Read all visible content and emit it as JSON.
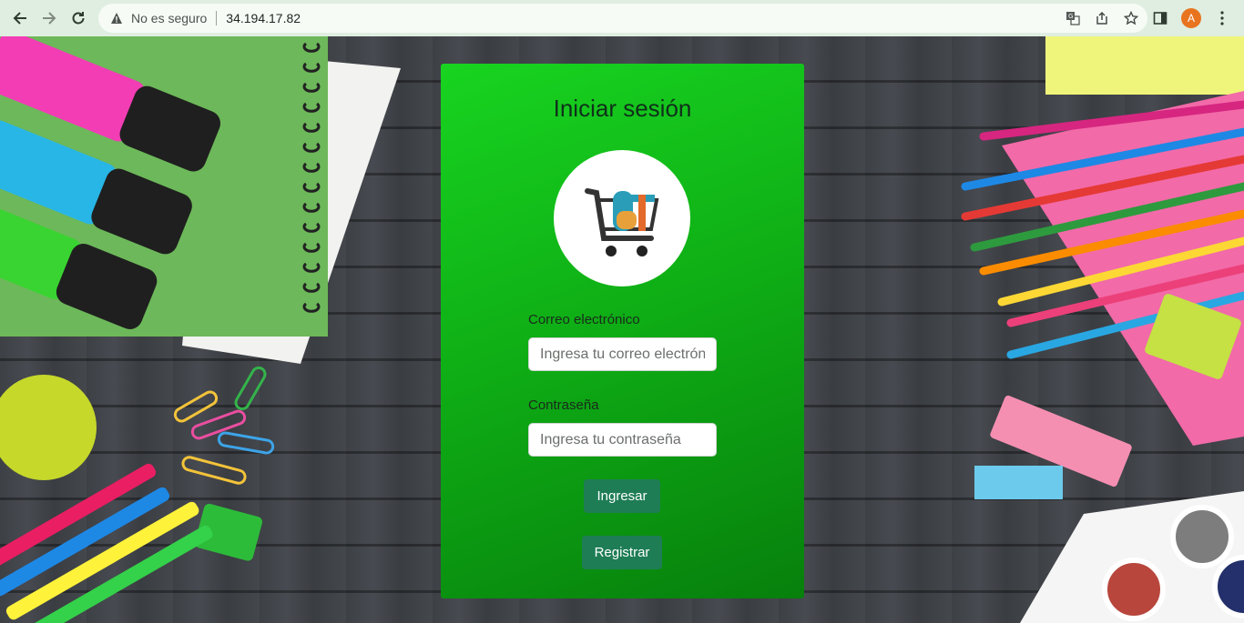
{
  "browser": {
    "security_label": "No es seguro",
    "url": "34.194.17.82",
    "avatar_letter": "A",
    "icons": [
      "back-icon",
      "forward-icon",
      "reload-icon",
      "warning-icon",
      "translate-icon",
      "share-icon",
      "bookmark-star-icon",
      "side-panel-icon",
      "profile-avatar",
      "menu-kebab-icon"
    ]
  },
  "login": {
    "title": "Iniciar sesión",
    "email_label": "Correo electrónico",
    "email_placeholder": "Ingresa tu correo electrónico",
    "password_label": "Contraseña",
    "password_placeholder": "Ingresa tu contraseña",
    "submit_label": "Ingresar",
    "register_label": "Registrar"
  },
  "colors": {
    "card_green": "#10c018",
    "button_green": "#1e7d55",
    "avatar_orange": "#e8741f"
  }
}
